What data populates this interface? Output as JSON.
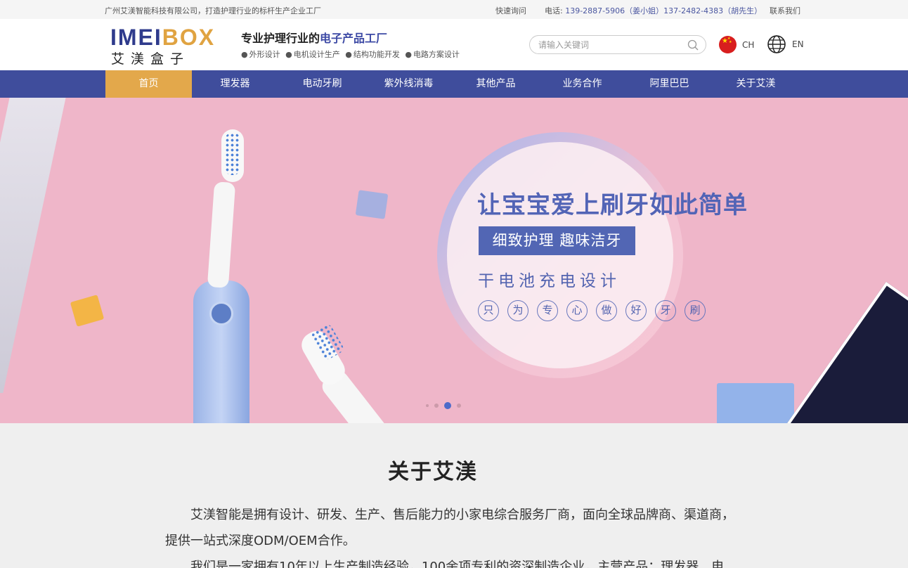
{
  "topbar": {
    "company": "广州艾渼智能科技有限公司，打造护理行业的标杆生产企业工厂",
    "quick_inquiry": "快速询问",
    "phone_label": "电话:",
    "phone1": "139-2887-5906（姜小姐）137-2482-4383（胡先生）",
    "contact": "联系我们"
  },
  "header": {
    "logo_part1": "IMEI",
    "logo_part2": "BOX",
    "logo_cn": "艾渼盒子",
    "slogan_a": "专业护理行业的",
    "slogan_b": "电子产品工厂",
    "tags": [
      "外形设计",
      "电机设计生产",
      "结构功能开发",
      "电路方案设计"
    ],
    "search_placeholder": "请输入关键词",
    "lang_ch": "CH",
    "lang_en": "EN"
  },
  "nav": {
    "items": [
      "首页",
      "理发器",
      "电动牙刷",
      "紫外线消毒",
      "其他产品",
      "业务合作",
      "阿里巴巴",
      "关于艾渼"
    ],
    "active": 0
  },
  "banner": {
    "title": "让宝宝爱上刷牙如此简单",
    "box": "细致护理 趣味洁牙",
    "sub": "干电池充电设计",
    "chars": [
      "只",
      "为",
      "专",
      "心",
      "做",
      "好",
      "牙",
      "刷"
    ],
    "slides": 4,
    "active_slide": 2
  },
  "about": {
    "title": "关于艾渼",
    "p1": "艾渼智能是拥有设计、研发、生产、售后能力的小家电综合服务厂商，面向全球品牌商、渠道商，提供一站式深度ODM/OEM合作。",
    "p2": "我们是一家拥有10年以上生产制造经验，100余项专利的资深制造企业，主营产品：理发器、电"
  },
  "colors": {
    "nav_bg": "#3f4d9c",
    "nav_active": "#e3a84b",
    "brand_blue": "#2f3b8c",
    "brand_gold": "#e0a341",
    "banner_pink": "#efb6c9"
  }
}
